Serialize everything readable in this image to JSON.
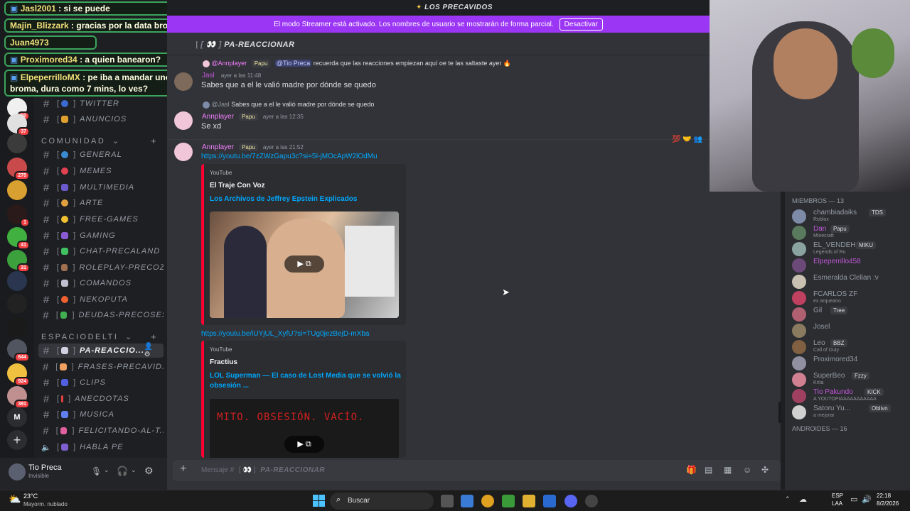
{
  "window": {
    "server_title": "LOS PRECAVIDOS"
  },
  "banner": {
    "text": "El modo Streamer está activado. Los nombres de usuario se mostrarán de forma parcial.",
    "button": "Desactivar"
  },
  "chat_overlay": [
    {
      "user": "Jasl2001",
      "text": ": si se puede"
    },
    {
      "user": "Majin_Blizzark",
      "text": ": gracias por la data bro"
    },
    {
      "user": "Juan4973",
      "text": ""
    },
    {
      "user": "Proximored34",
      "text": ": a quien banearon?"
    },
    {
      "user": "ElpeperrilloMX",
      "text": ": pe iba a mandar uno de",
      "text2": "broma, dura como 7 mins, lo ves?"
    }
  ],
  "rail": {
    "badges": [
      "80",
      "37",
      "275",
      "1",
      "41",
      "31",
      "644",
      "924",
      "391"
    ],
    "m_label": "M"
  },
  "channels": {
    "top": [
      {
        "name": "TWITTER"
      },
      {
        "name": "ANUNCIOS"
      }
    ],
    "cat1": "COMUNIDAD",
    "community": [
      {
        "name": "GENERAL"
      },
      {
        "name": "MEMES"
      },
      {
        "name": "MULTIMEDIA"
      },
      {
        "name": "ARTE"
      },
      {
        "name": "FREE-GAMES"
      },
      {
        "name": "GAMING"
      },
      {
        "name": "CHAT-PRECALAND"
      },
      {
        "name": "ROLEPLAY-PRECOZ"
      },
      {
        "name": "COMANDOS"
      },
      {
        "name": "NEKOPUTA"
      },
      {
        "name": "DEUDAS-PRECOSES"
      }
    ],
    "cat2": "ESPACIODELTI",
    "espacio": [
      {
        "name": "PA-REACCIO..."
      },
      {
        "name": "FRASES-PRECAVID..."
      },
      {
        "name": "CLIPS"
      },
      {
        "name": "ANECDOTAS"
      },
      {
        "name": "MUSICA"
      },
      {
        "name": "FELICITANDO-AL-T..."
      },
      {
        "name": "HABLA PE"
      }
    ]
  },
  "user_panel": {
    "name": "Tio Preca",
    "status": "Invisible"
  },
  "channel_header": {
    "name": "PA-REACCIONAR"
  },
  "messages": {
    "reply1": {
      "author": "@Annplayer",
      "role": "Papu",
      "mention": "@Tio Preca",
      "text": "recuerda que las reacciones empiezan aquí oe te las saltaste ayer"
    },
    "m1": {
      "author": "Jasl",
      "time": "ayer a las 11:48",
      "text": "Sabes que a el le valió madre por dónde se quedo"
    },
    "reply2": {
      "author": "@Jasl",
      "text": "Sabes que a el le valió madre por dónde se quedo"
    },
    "m2": {
      "author": "Annplayer",
      "role": "Papu",
      "time": "ayer a las 12:35",
      "text": "Se xd"
    },
    "m3": {
      "author": "Annplayer",
      "role": "Papu",
      "time": "ayer a las 21:52",
      "link1": "https://youtu.be/7zZWzGapu3c?si=5I-jMOcApW2lOdMu",
      "link2": "https://youtu.be/iUYjUL_XyfU?si=TUg0jezBejD-mXba"
    },
    "embed1": {
      "provider": "YouTube",
      "channel": "El Traje Con Voz",
      "title": "Los Archivos de Jeffrey Epstein Explicados"
    },
    "embed2": {
      "provider": "YouTube",
      "channel": "Fractius",
      "title1": "LOL Superman — El caso de Lost Media que se volvió la",
      "title2": "obsesión ...",
      "thumb_text": "MITO. OBSESIÓN. VACÍO."
    }
  },
  "composer": {
    "placeholder": "Mensaje #",
    "channel": "PA-REACCIONAR"
  },
  "members": {
    "header": "MIEMBROS — 13",
    "list": [
      {
        "name": "chambiadaiks",
        "tag": "TDS",
        "sub": "Roblox",
        "color": "#949ba4",
        "av": "#7d8ba8"
      },
      {
        "name": "Dan",
        "tag": "Papu",
        "sub": "Minecraft",
        "color": "#c157d8",
        "av": "#5a7a5e"
      },
      {
        "name": "EL_VENDEH",
        "tag": "MIKU",
        "sub": "Legends of Ru",
        "color": "#949ba4",
        "av": "#8aa3a0"
      },
      {
        "name": "Elpeperrillo458",
        "tag": "",
        "sub": "",
        "color": "#c157d8",
        "av": "#6b4a7a"
      },
      {
        "name": "Esmeralda Clelian :v",
        "tag": "",
        "sub": "",
        "color": "#949ba4",
        "av": "#c8c0b0"
      },
      {
        "name": "FCARLOS ZF",
        "tag": "",
        "sub": "ex arqueano",
        "color": "#949ba4",
        "av": "#c04060"
      },
      {
        "name": "Gil",
        "tag": "Tree",
        "sub": "",
        "color": "#949ba4",
        "av": "#b06070"
      },
      {
        "name": "Josel",
        "tag": "",
        "sub": "",
        "color": "#949ba4",
        "av": "#8a7a60"
      },
      {
        "name": "Leo",
        "tag": "BBZ",
        "sub": "Call of Duty",
        "color": "#949ba4",
        "av": "#806040"
      },
      {
        "name": "Proximored34",
        "tag": "",
        "sub": "",
        "color": "#949ba4",
        "av": "#9090a0"
      },
      {
        "name": "SuperBeo",
        "tag": "Fzzy",
        "sub": "Krita",
        "color": "#949ba4",
        "av": "#d08090"
      },
      {
        "name": "Tio Pakundo",
        "tag": "KICK",
        "sub": "A YOUTOPIAAAAAAAAAAA",
        "color": "#c157d8",
        "av": "#a04060"
      },
      {
        "name": "Satoru Yu...",
        "tag": "Oblivn",
        "sub": "a mejorar",
        "color": "#949ba4",
        "av": "#d0d0d0"
      }
    ],
    "next_header": "ANDROIDES — 16"
  },
  "taskbar": {
    "weather_temp": "23°C",
    "weather_desc": "Mayorm. nublado",
    "search": "Buscar",
    "lang1": "ESP",
    "lang2": "LAA",
    "time": "22:18",
    "date": "8/2/2026"
  }
}
